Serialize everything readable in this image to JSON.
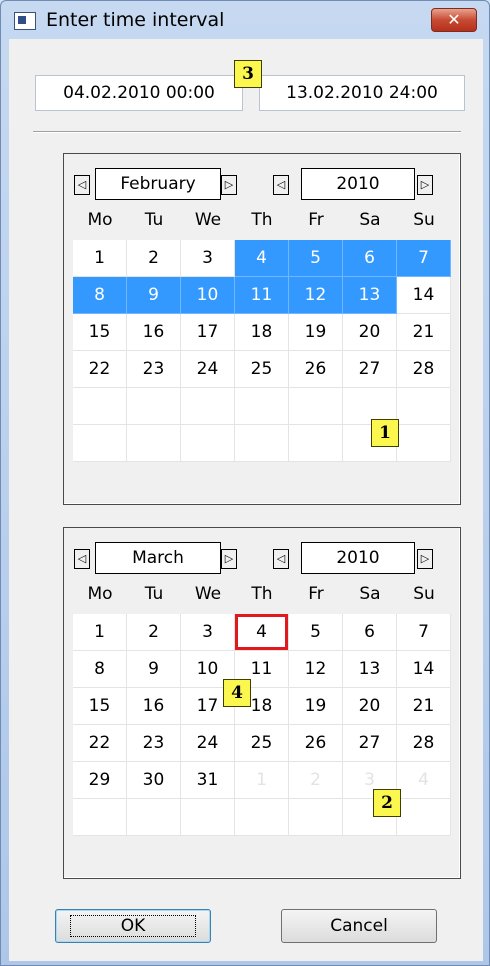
{
  "window": {
    "title": "Enter time interval",
    "close_symbol": "✕"
  },
  "interval": {
    "start": "04.02.2010 00:00",
    "end": "13.02.2010 24:00"
  },
  "callouts": {
    "c1": "1",
    "c2": "2",
    "c3": "3",
    "c4": "4"
  },
  "nav": {
    "prev": "◁",
    "next": "▷"
  },
  "weekdays": [
    "Mo",
    "Tu",
    "We",
    "Th",
    "Fr",
    "Sa",
    "Su"
  ],
  "calendar1": {
    "month": "February",
    "year": "2010",
    "rows": [
      [
        "1",
        "2",
        "3",
        "4",
        "5",
        "6",
        "7"
      ],
      [
        "8",
        "9",
        "10",
        "11",
        "12",
        "13",
        "14"
      ],
      [
        "15",
        "16",
        "17",
        "18",
        "19",
        "20",
        "21"
      ],
      [
        "22",
        "23",
        "24",
        "25",
        "26",
        "27",
        "28"
      ],
      [
        "",
        "",
        "",
        "",
        "",
        "",
        ""
      ],
      [
        "",
        "",
        "",
        "",
        "",
        "",
        ""
      ]
    ],
    "selected": [
      [
        0,
        3
      ],
      [
        0,
        4
      ],
      [
        0,
        5
      ],
      [
        0,
        6
      ],
      [
        1,
        0
      ],
      [
        1,
        1
      ],
      [
        1,
        2
      ],
      [
        1,
        3
      ],
      [
        1,
        4
      ],
      [
        1,
        5
      ]
    ]
  },
  "calendar2": {
    "month": "March",
    "year": "2010",
    "rows": [
      [
        "1",
        "2",
        "3",
        "4",
        "5",
        "6",
        "7"
      ],
      [
        "8",
        "9",
        "10",
        "11",
        "12",
        "13",
        "14"
      ],
      [
        "15",
        "16",
        "17",
        "18",
        "19",
        "20",
        "21"
      ],
      [
        "22",
        "23",
        "24",
        "25",
        "26",
        "27",
        "28"
      ],
      [
        "29",
        "30",
        "31",
        "1",
        "2",
        "3",
        "4"
      ],
      [
        "",
        "",
        "",
        "",
        "",
        "",
        ""
      ]
    ],
    "dimmed": [
      [
        4,
        3
      ],
      [
        4,
        4
      ],
      [
        4,
        5
      ],
      [
        4,
        6
      ]
    ],
    "today": [
      0,
      3
    ]
  },
  "buttons": {
    "ok": "OK",
    "cancel": "Cancel"
  },
  "colors": {
    "selection": "#3399ff",
    "today_outline": "#e0191e",
    "callout": "#fbf74f"
  }
}
